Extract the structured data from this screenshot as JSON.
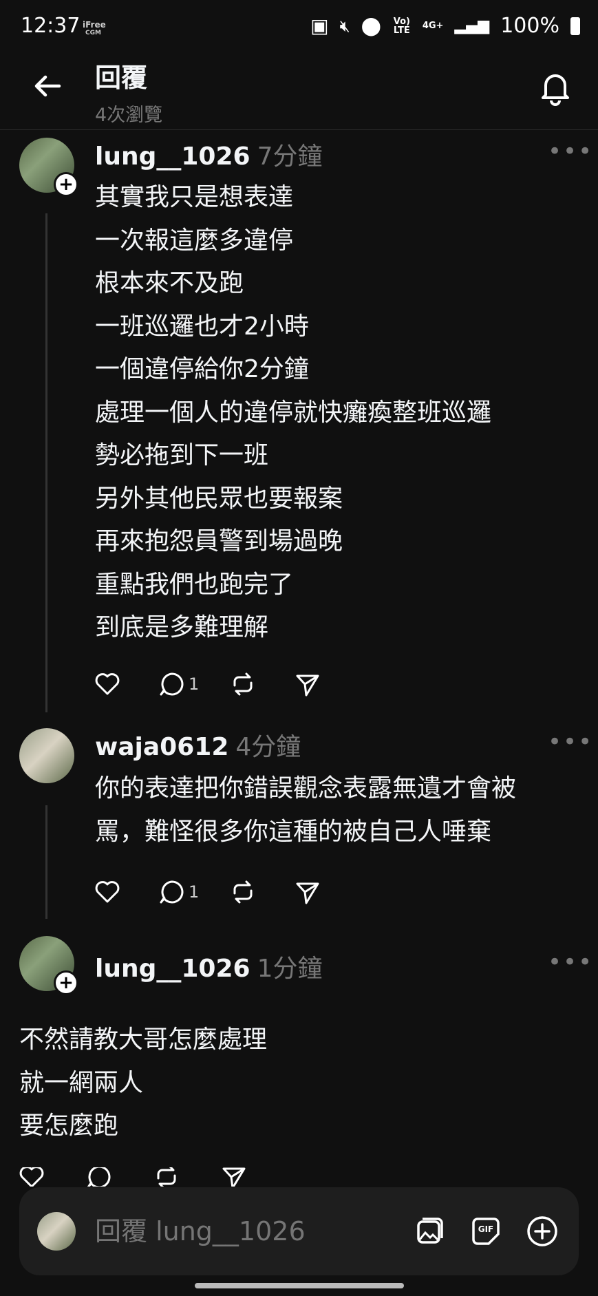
{
  "status_bar": {
    "time": "12:37",
    "carrier_line1": "iFree",
    "carrier_line2": "CGM",
    "volte": "Vo) LTE",
    "network": "4G+",
    "battery": "100%"
  },
  "header": {
    "title": "回覆",
    "views": "4次瀏覽"
  },
  "posts": [
    {
      "username": "lung__1026",
      "time": "7分鐘",
      "text": "其實我只是想表達\n一次報這麼多違停\n根本來不及跑\n一班巡邏也才2小時\n一個違停給你2分鐘\n處理一個人的違停就快癱瘓整班巡邏\n勢必拖到下一班\n另外其他民眾也要報案\n再來抱怨員警到場過晚\n重點我們也跑完了\n到底是多難理解",
      "reply_count": "1"
    },
    {
      "username": "waja0612",
      "time": "4分鐘",
      "text": "你的表達把你錯誤觀念表露無遺才會被\n罵，難怪很多你這種的被自己人唾棄",
      "reply_count": "1"
    },
    {
      "username": "lung__1026",
      "time": "1分鐘",
      "text": "不然請教大哥怎麼處理\n就一網兩人\n要怎麼跑"
    }
  ],
  "composer": {
    "placeholder": "回覆 lung__1026"
  },
  "colors": {
    "background": "#101010",
    "text": "#f3f5f7",
    "muted": "#777777"
  }
}
